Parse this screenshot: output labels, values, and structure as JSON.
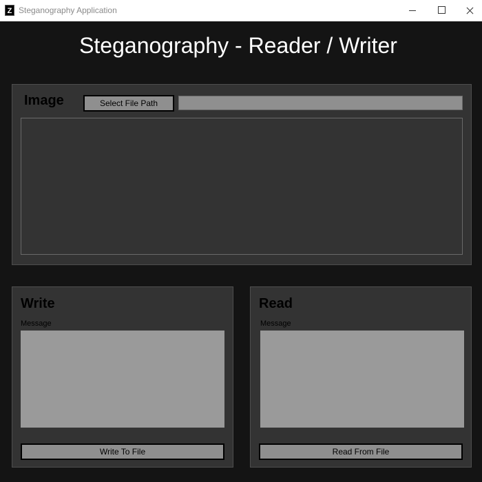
{
  "window": {
    "title": "Steganography Application",
    "icon_glyph": "Z"
  },
  "page": {
    "title": "Steganography - Reader / Writer"
  },
  "image_section": {
    "heading": "Image",
    "select_button_label": "Select File Path",
    "file_path_value": ""
  },
  "write_section": {
    "heading": "Write",
    "message_label": "Message",
    "message_value": "",
    "button_label": "Write To File"
  },
  "read_section": {
    "heading": "Read",
    "message_label": "Message",
    "message_value": "",
    "button_label": "Read From File"
  },
  "colors": {
    "background": "#141414",
    "panel": "#333333",
    "control": "#8f8f8f"
  },
  "icons": [
    "app-icon",
    "minimize-icon",
    "maximize-icon",
    "close-icon"
  ]
}
